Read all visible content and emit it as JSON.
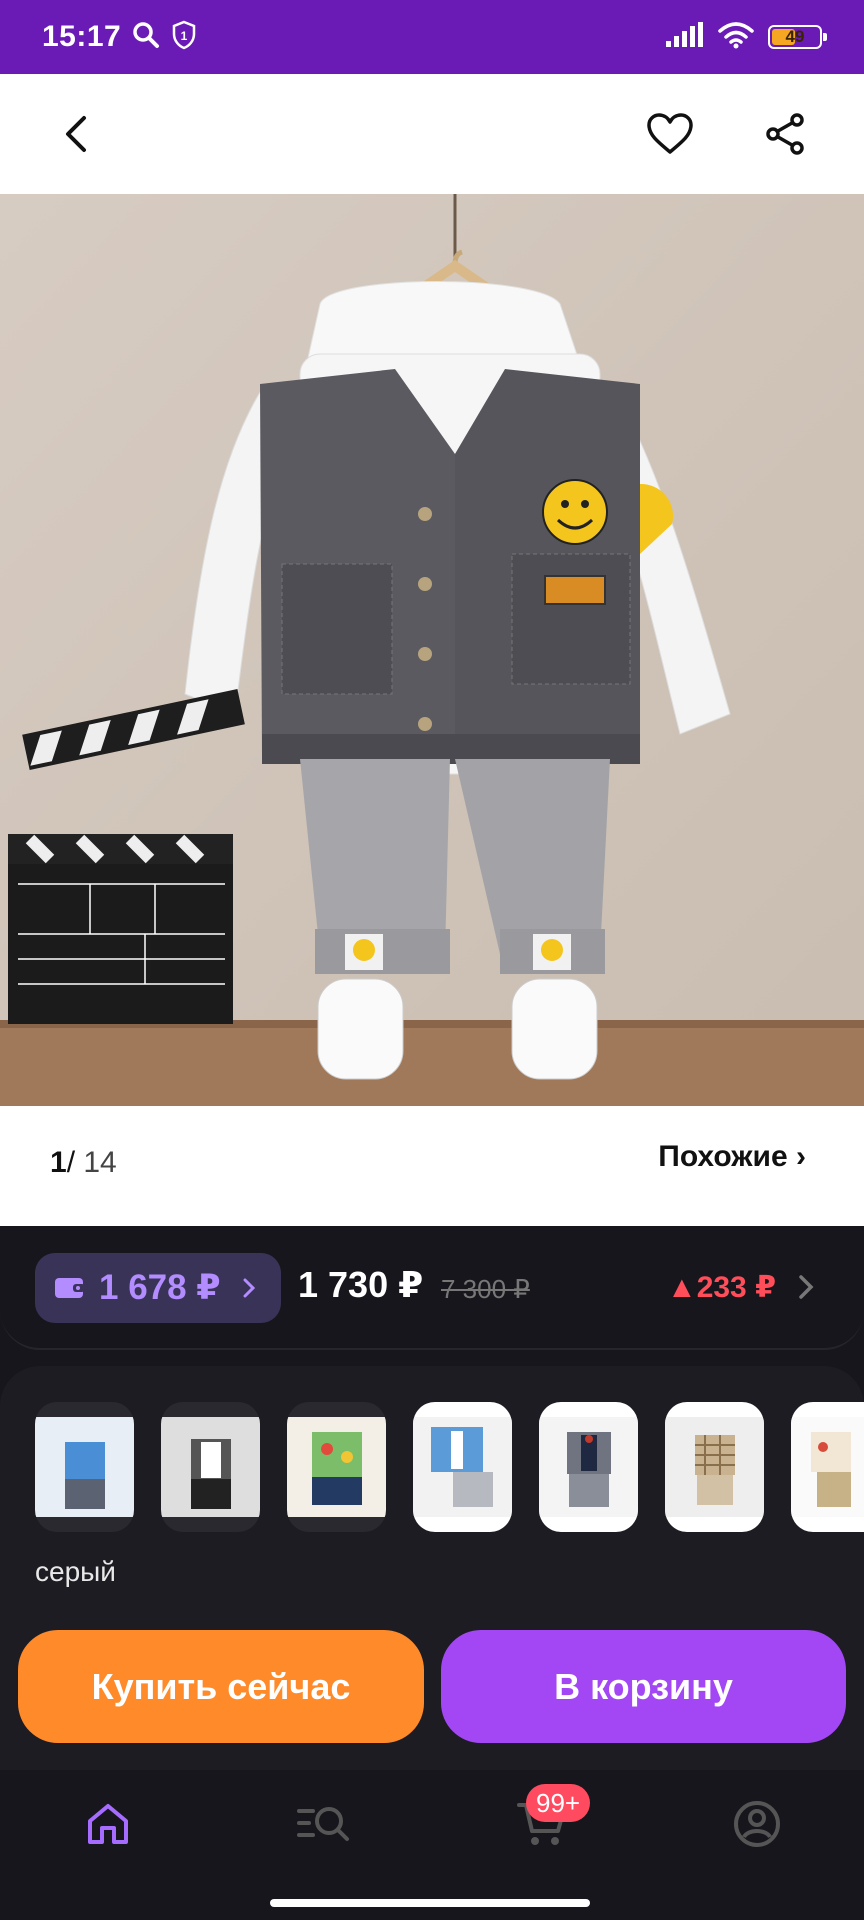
{
  "status_bar": {
    "time": "15:17",
    "battery_level": "49",
    "battery_percent": 0.49
  },
  "gallery": {
    "current": "1",
    "separator": "/",
    "total": "14",
    "similar_label": "Похожие ›"
  },
  "prices": {
    "wallet_price": "1 678 ₽",
    "price": "1 730 ₽",
    "old_price": "7 300 ₽",
    "difference": "▲233 ₽"
  },
  "variants": {
    "selected_color": "серый",
    "count_visible": 7
  },
  "actions": {
    "buy_now": "Купить сейчас",
    "add_to_cart": "В корзину"
  },
  "tab_bar": {
    "cart_badge": "99+"
  },
  "colors": {
    "status_bar": "#6a1bb5",
    "accent_purple": "#a347f5",
    "accent_orange": "#ff8a2a",
    "price_up": "#ff4d5a",
    "background": "#17161c"
  },
  "icons": [
    "search-icon",
    "shield-icon",
    "signal-icon",
    "wifi-icon",
    "battery-icon",
    "back-arrow-icon",
    "heart-icon",
    "share-icon",
    "wallet-icon",
    "chevron-right-icon",
    "home-icon",
    "catalog-search-icon",
    "cart-icon",
    "profile-icon"
  ]
}
